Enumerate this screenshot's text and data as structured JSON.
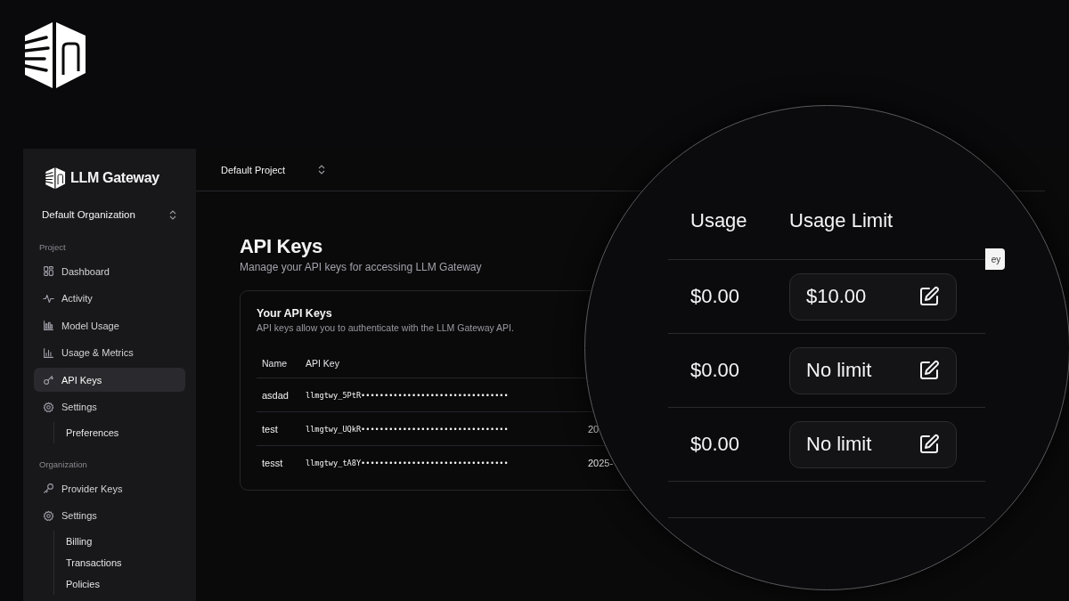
{
  "brand": {
    "name": "LLM Gateway"
  },
  "organization_select": {
    "value": "Default Organization"
  },
  "sidebar": {
    "sections": [
      {
        "title": "Project",
        "items": [
          {
            "label": "Dashboard",
            "kind": "dashboard",
            "selected": false
          },
          {
            "label": "Activity",
            "kind": "activity",
            "selected": false
          },
          {
            "label": "Model Usage",
            "kind": "models",
            "selected": false
          },
          {
            "label": "Usage & Metrics",
            "kind": "metrics",
            "selected": false
          },
          {
            "label": "API Keys",
            "kind": "keys",
            "selected": true
          },
          {
            "label": "Settings",
            "kind": "settings",
            "selected": false,
            "children": [
              {
                "label": "Preferences",
                "selected": false
              }
            ]
          }
        ]
      },
      {
        "title": "Organization",
        "items": [
          {
            "label": "Provider Keys",
            "kind": "providers",
            "selected": false
          },
          {
            "label": "Settings",
            "kind": "settings",
            "selected": false,
            "children": [
              {
                "label": "Billing",
                "selected": false
              },
              {
                "label": "Transactions",
                "selected": false
              },
              {
                "label": "Policies",
                "selected": false
              }
            ]
          }
        ]
      }
    ]
  },
  "project_select": {
    "value": "Default Project"
  },
  "page": {
    "title": "API Keys",
    "subtitle": "Manage your API keys for accessing LLM Gateway"
  },
  "card": {
    "title": "Your API Keys",
    "description": "API keys allow you to authenticate with the LLM Gateway API.",
    "table": {
      "columns": [
        "Name",
        "API Key"
      ],
      "rows": [
        {
          "name": "asdad",
          "api_key": "llmgtwy_5PtR••••••••••••••••••••••••••••••••"
        },
        {
          "name": "test",
          "api_key": "llmgtwy_UQkR••••••••••••••••••••••••••••••••",
          "column_3": "20"
        },
        {
          "name": "tesst",
          "api_key": "llmgtwy_tA8Y••••••••••••••••••••••••••••••••",
          "column_3": "2025-"
        }
      ]
    }
  },
  "magnifier": {
    "columns": [
      "Usage",
      "Usage Limit"
    ],
    "rows": [
      {
        "usage": "$0.00",
        "usage_limit": "$10.00"
      },
      {
        "usage": "$0.00",
        "usage_limit": "No limit"
      },
      {
        "usage": "$0.00",
        "usage_limit": "No limit"
      }
    ],
    "partial_button": "ey"
  }
}
